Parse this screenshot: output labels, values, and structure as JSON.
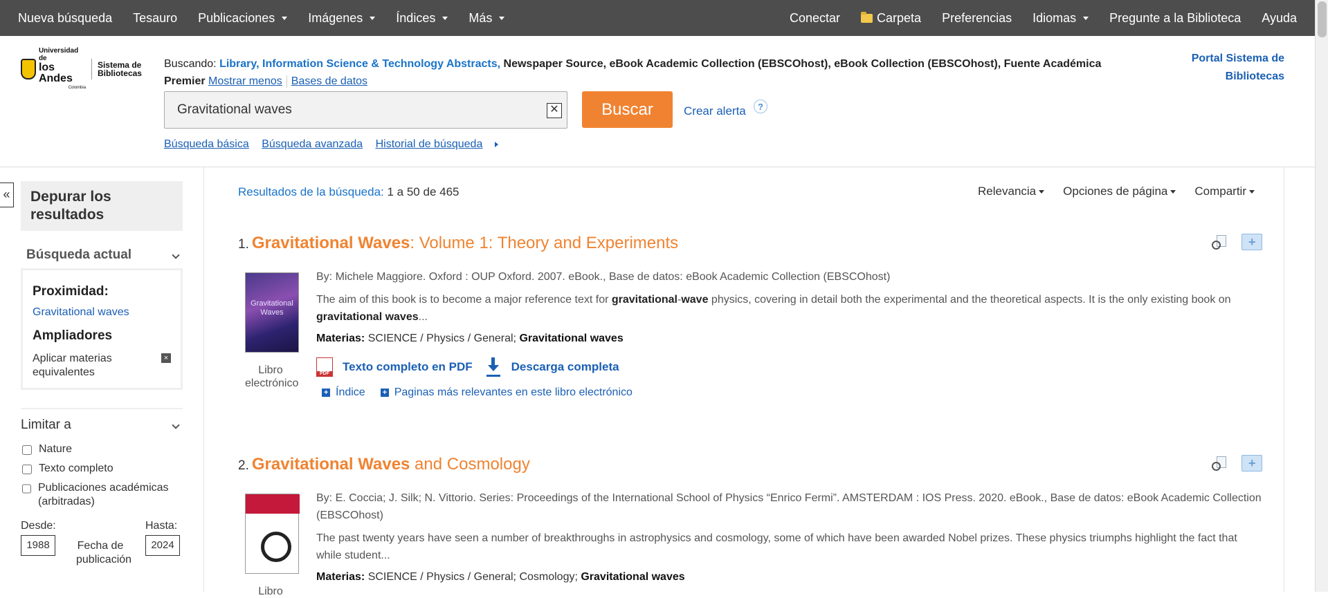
{
  "topnav": {
    "left": [
      {
        "label": "Nueva búsqueda",
        "dropdown": false
      },
      {
        "label": "Tesauro",
        "dropdown": false
      },
      {
        "label": "Publicaciones",
        "dropdown": true
      },
      {
        "label": "Imágenes",
        "dropdown": true
      },
      {
        "label": "Índices",
        "dropdown": true
      },
      {
        "label": "Más",
        "dropdown": true
      }
    ],
    "right": {
      "conectar": "Conectar",
      "carpeta": "Carpeta",
      "preferencias": "Preferencias",
      "idiomas": "Idiomas",
      "pregunte": "Pregunte a la Biblioteca",
      "ayuda": "Ayuda"
    }
  },
  "logo": {
    "university_line1": "Universidad de",
    "university_line2": "los Andes",
    "country": "Colombia",
    "system_line1": "Sistema de",
    "system_line2": "Bibliotecas"
  },
  "header": {
    "searching_label": "Buscando:",
    "highlight_db": "Library, Information Science & Technology Abstracts,",
    "other_dbs": "Newspaper Source, eBook Academic Collection (EBSCOhost), eBook Collection (EBSCOhost), Fuente Académica Premier",
    "show_less": "Mostrar menos",
    "databases": "Bases de datos",
    "portal": "Portal Sistema de Bibliotecas"
  },
  "search": {
    "value": "Gravitational waves",
    "clear_symbol": "✕",
    "button": "Buscar",
    "create_alert": "Crear alerta",
    "help": "?"
  },
  "sublinks": {
    "basic": "Búsqueda básica",
    "advanced": "Búsqueda avanzada",
    "history": "Historial de búsqueda"
  },
  "sidebar": {
    "collapse": "«",
    "refine_title": "Depurar los resultados",
    "current_search": "Búsqueda actual",
    "proximity_label": "Proximidad:",
    "proximity_term": "Gravitational waves",
    "expanders_label": "Ampliadores",
    "expander_item": "Aplicar materias equivalentes",
    "expander_remove": "×",
    "limit_to": "Limitar a",
    "checkboxes": [
      {
        "label": "Nature",
        "checked": false
      },
      {
        "label": "Texto completo",
        "checked": false
      },
      {
        "label": "Publicaciones académicas (arbitradas)",
        "checked": false
      }
    ],
    "from_label": "Desde:",
    "to_label": "Hasta:",
    "from_value": "1988",
    "to_value": "2024",
    "date_label": "Fecha de publicación"
  },
  "results": {
    "count_label": "Resultados de la búsqueda:",
    "count_value": "1 a 50 de 465",
    "sort": "Relevancia",
    "page_options": "Opciones de página",
    "share": "Compartir",
    "items": [
      {
        "num": "1.",
        "title_bold": "Gravitational Waves",
        "title_rest": ": Volume 1: Theory and Experiments",
        "meta": "By: Michele Maggiore. Oxford : OUP Oxford. 2007. eBook., Base de datos: eBook Academic Collection (EBSCOhost)",
        "abstract_pre": "The aim of this book is to become a major reference text for ",
        "abstract_b1": "gravitational",
        "abstract_mid": "-",
        "abstract_b2": "wave",
        "abstract_post": " physics, covering in detail both the experimental and the theoretical aspects. It is the only existing book on ",
        "abstract_b3": "gravitational waves",
        "abstract_end": "...",
        "subjects_label": "Materias:",
        "subjects": "SCIENCE / Physics / General; ",
        "subjects_bold": "Gravitational waves",
        "type": "Libro electrónico",
        "pdf_link": "Texto completo en PDF",
        "download_link": "Descarga completa",
        "index_link": "Índice",
        "pages_link": "Paginas más relevantes en este libro electrónico"
      },
      {
        "num": "2.",
        "title_bold": "Gravitational Waves",
        "title_rest": " and Cosmology",
        "meta": "By: E. Coccia; J. Silk; N. Vittorio. Series: Proceedings of the International School of Physics “Enrico Fermi”. AMSTERDAM : IOS Press. 2020. eBook., Base de datos: eBook Academic Collection (EBSCOhost)",
        "abstract": "The past twenty years have seen a number of breakthroughs in astrophysics and cosmology, some of which have been awarded Nobel prizes. These physics triumphs highlight the fact that while student...",
        "subjects_label": "Materias:",
        "subjects": "SCIENCE / Physics / General; Cosmology; ",
        "subjects_bold": "Gravitational waves",
        "type": "Libro"
      }
    ]
  },
  "colors": {
    "nav_bg": "#4d4d4d",
    "accent_orange": "#f08331",
    "link_blue": "#1a5fb4"
  }
}
